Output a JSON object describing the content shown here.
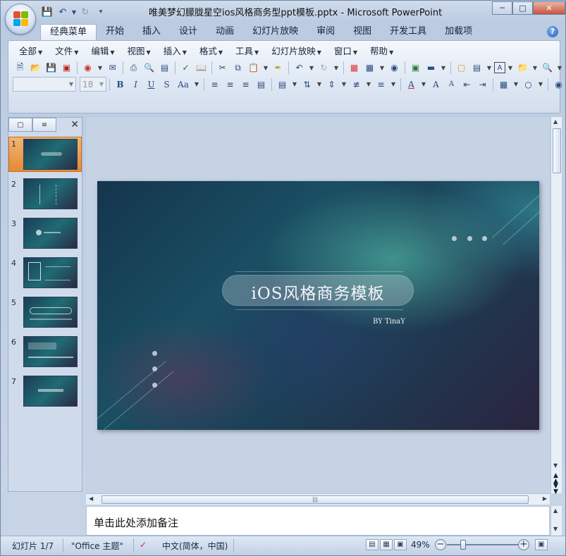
{
  "window": {
    "title": "唯美梦幻朦胧星空ios风格商务型ppt模板.pptx - Microsoft PowerPoint",
    "controls": [
      "minimize-icon",
      "maximize-icon",
      "close-icon"
    ]
  },
  "quick_access": [
    "save-icon",
    "undo-icon",
    "redo-icon",
    "customize-icon"
  ],
  "ribbon_tabs": [
    "经典菜单",
    "开始",
    "插入",
    "设计",
    "动画",
    "幻灯片放映",
    "审阅",
    "视图",
    "开发工具",
    "加载项"
  ],
  "active_tab": "经典菜单",
  "menus": [
    "全部",
    "文件",
    "编辑",
    "视图",
    "插入",
    "格式",
    "工具",
    "幻灯片放映",
    "窗口",
    "帮助"
  ],
  "format_bar": {
    "font_name": "",
    "font_size": "18"
  },
  "slides_pane": {
    "tabs": [
      "slides-tab-icon",
      "outline-tab-icon"
    ],
    "numbers": [
      "1",
      "2",
      "3",
      "4",
      "5",
      "6",
      "7"
    ],
    "selected": "1"
  },
  "slide": {
    "title": "iOS风格商务模板",
    "byline": "BY TinaY"
  },
  "notes": {
    "placeholder": "单击此处添加备注"
  },
  "status": {
    "slide_info": "幻灯片 1/7",
    "theme": "\"Office 主题\"",
    "language": "中文(简体，中国)",
    "zoom": "49%"
  },
  "colors": {
    "accent": "#e58a33",
    "ribbon": "#dfe8f4",
    "slide_bg": "#1a4f63"
  }
}
